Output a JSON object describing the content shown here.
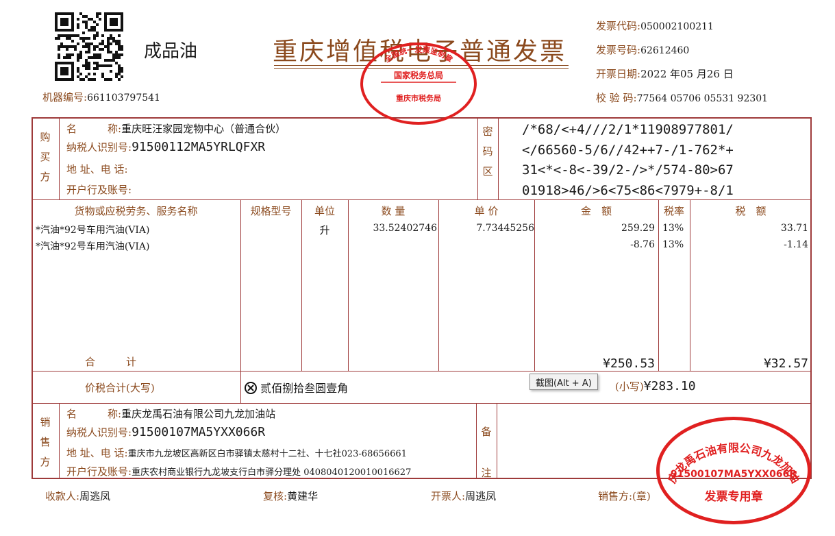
{
  "header": {
    "title": "重庆增值税电子普通发票",
    "category": "成品油",
    "machine_label": "机器编号:",
    "machine_no": "661103797541",
    "code_label": "发票代码:",
    "code_value": "050002100211",
    "number_label": "发票号码:",
    "number_value": "62612460",
    "date_label": "开票日期:",
    "date_value": "2022 年05 月26 日",
    "check_label": "校 验 码:",
    "check_value": "77564 05706 05531 92301"
  },
  "buyer": {
    "side_label": [
      "购",
      "买",
      "方"
    ],
    "name_label": "名　　　称:",
    "name_value": "重庆旺汪家园宠物中心（普通合伙）",
    "tax_label": "纳税人识别号:",
    "tax_value": "91500112MA5YRLQFXR",
    "addr_label": "地 址、电 话:",
    "addr_value": "",
    "bank_label": "开户行及账号:",
    "bank_value": ""
  },
  "cipher": {
    "side_label": [
      "密",
      "码",
      "区"
    ],
    "lines": [
      "/*68/<+4///2/1*11908977801/",
      "</66560-5/6//42++7-/1-762*+",
      "31<*<-8<-39/2-/>*/574-80>67",
      "01918>46/>6<75<86<7979+-8/1"
    ]
  },
  "items": {
    "headers": {
      "name": "货物或应税劳务、服务名称",
      "spec": "规格型号",
      "unit": "单位",
      "qty": "数 量",
      "price": "单 价",
      "amount": "金　额",
      "rate": "税率",
      "tax": "税　额"
    },
    "rows": [
      {
        "name": "*汽油*92号车用汽油(VIA)",
        "spec": "",
        "unit": "升",
        "qty": "33.52402746",
        "price": "7.73445256",
        "amount": "259.29",
        "rate": "13%",
        "tax": "33.71"
      },
      {
        "name": "*汽油*92号车用汽油(VIA)",
        "spec": "",
        "unit": "",
        "qty": "",
        "price": "",
        "amount": "-8.76",
        "rate": "13%",
        "tax": "-1.14"
      }
    ],
    "total_label": "合　　　计",
    "total_amount": "¥250.53",
    "total_tax": "¥32.57"
  },
  "summary": {
    "label": "价税合计(大写)",
    "uppercase": "贰佰捌拾叁圆壹角",
    "small_label": "(小写)",
    "small_value": "¥283.10"
  },
  "seller": {
    "side_label": [
      "销",
      "售",
      "方"
    ],
    "name_label": "名　　　称:",
    "name_value": "重庆龙禹石油有限公司九龙加油站",
    "tax_label": "纳税人识别号:",
    "tax_value": "91500107MA5YXX066R",
    "addr_label": "地 址、电 话:",
    "addr_value": "重庆市九龙坡区高新区白市驿镇太慈村十二社、十七社023-68656661",
    "bank_label": "开户行及账号:",
    "bank_value": "重庆农村商业银行九龙坡支行白市驿分理处 0408040120010016627"
  },
  "remark": {
    "side_label": [
      "备",
      "注"
    ]
  },
  "footer": {
    "payee_label": "收款人:",
    "payee_value": "周逃凤",
    "review_label": "复核:",
    "review_value": "黄建华",
    "issuer_label": "开票人:",
    "issuer_value": "周逃凤",
    "seller_label": "销售方:(章)"
  },
  "stamps": {
    "tax_bureau": {
      "top": "全国统一发票监制章",
      "middle": "国家税务总局",
      "bottom": "重庆市税务局"
    },
    "seller": {
      "arc": "重庆龙禹石油有限公司九龙加油站",
      "id": "91500107MA5YXX066R",
      "bottom": "发票专用章"
    }
  },
  "tooltip": {
    "text": "截图(Alt + A)"
  },
  "colors": {
    "border": "#9e3a3a",
    "label": "#8b4a1e",
    "stamp": "#e02020"
  }
}
